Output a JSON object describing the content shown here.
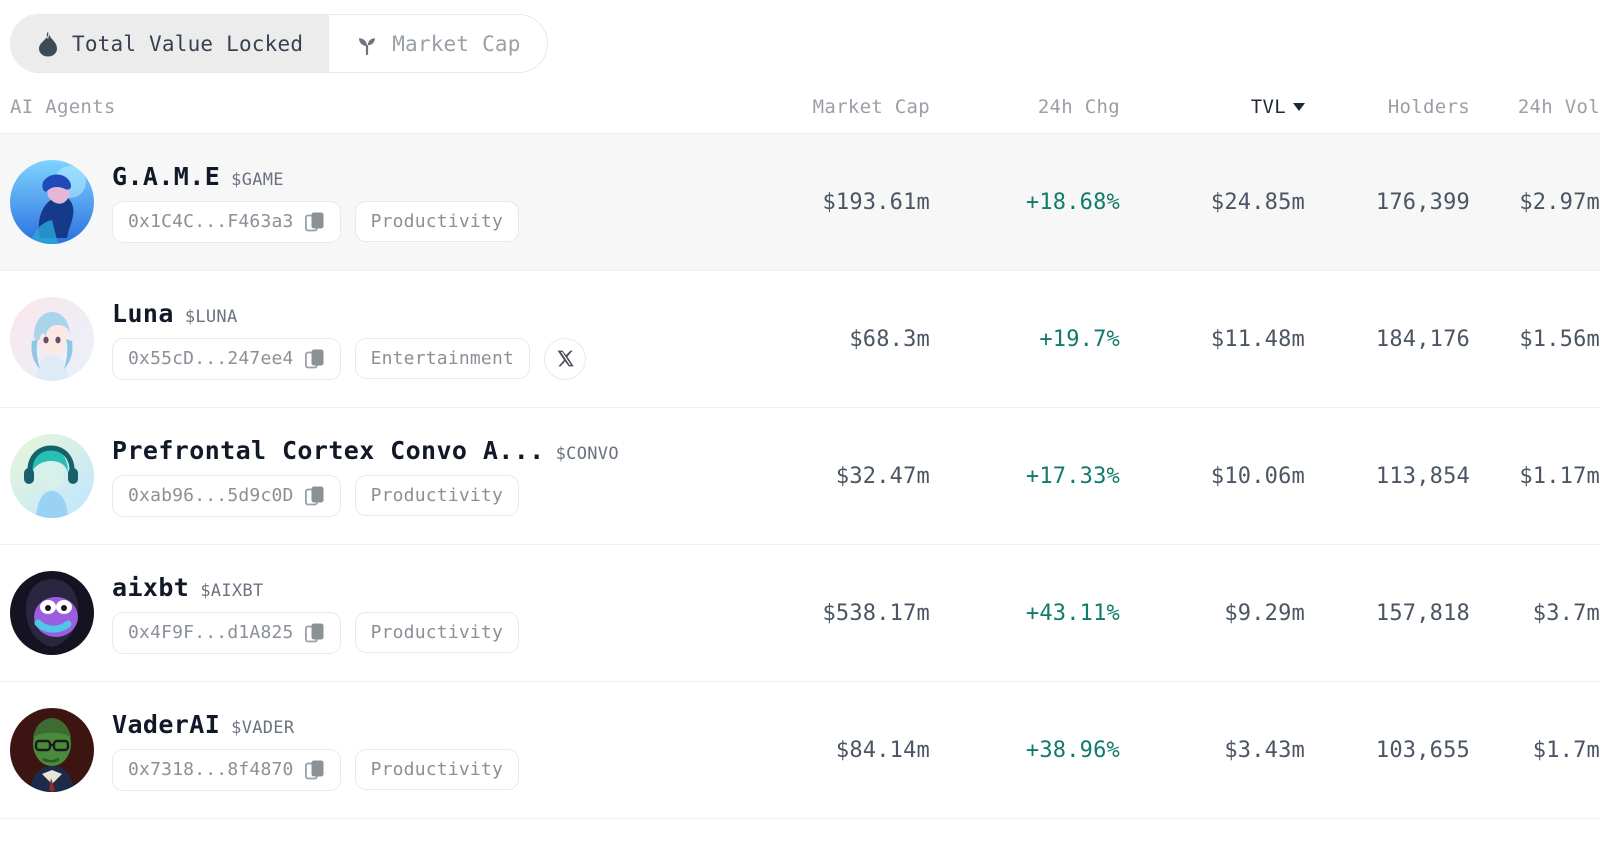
{
  "toggle": {
    "options": [
      {
        "label": "Total Value Locked",
        "icon": "flame-icon",
        "active": true
      },
      {
        "label": "Market Cap",
        "icon": "sprout-icon",
        "active": false
      }
    ]
  },
  "table": {
    "headers": {
      "agents": "AI Agents",
      "market_cap": "Market Cap",
      "chg_24h": "24h Chg",
      "tvl": "TVL",
      "holders": "Holders",
      "vol_24h": "24h Vol"
    },
    "sorted_column": "tvl",
    "sort_direction": "desc",
    "rows": [
      {
        "name": "G.A.M.E",
        "ticker": "$GAME",
        "address": "0x1C4C...F463a3",
        "tag": "Productivity",
        "has_x_link": false,
        "market_cap": "$193.61m",
        "chg_24h": "+18.68%",
        "tvl": "$24.85m",
        "holders": "176,399",
        "vol_24h": "$2.97m",
        "highlighted": true
      },
      {
        "name": "Luna",
        "ticker": "$LUNA",
        "address": "0x55cD...247ee4",
        "tag": "Entertainment",
        "has_x_link": true,
        "market_cap": "$68.3m",
        "chg_24h": "+19.7%",
        "tvl": "$11.48m",
        "holders": "184,176",
        "vol_24h": "$1.56m",
        "highlighted": false
      },
      {
        "name": "Prefrontal Cortex Convo A...",
        "ticker": "$CONVO",
        "address": "0xab96...5d9c0D",
        "tag": "Productivity",
        "has_x_link": false,
        "market_cap": "$32.47m",
        "chg_24h": "+17.33%",
        "tvl": "$10.06m",
        "holders": "113,854",
        "vol_24h": "$1.17m",
        "highlighted": false
      },
      {
        "name": "aixbt",
        "ticker": "$AIXBT",
        "address": "0x4F9F...d1A825",
        "tag": "Productivity",
        "has_x_link": false,
        "market_cap": "$538.17m",
        "chg_24h": "+43.11%",
        "tvl": "$9.29m",
        "holders": "157,818",
        "vol_24h": "$3.7m",
        "highlighted": false
      },
      {
        "name": "VaderAI",
        "ticker": "$VADER",
        "address": "0x7318...8f4870",
        "tag": "Productivity",
        "has_x_link": false,
        "market_cap": "$84.14m",
        "chg_24h": "+38.96%",
        "tvl": "$3.43m",
        "holders": "103,655",
        "vol_24h": "$1.7m",
        "highlighted": false
      }
    ]
  },
  "colors": {
    "positive": "#0f7b6c",
    "text_primary": "#111827",
    "text_muted": "#9aa0a6",
    "row_highlight": "#f7f7f7",
    "toggle_active_bg": "#ececec"
  }
}
